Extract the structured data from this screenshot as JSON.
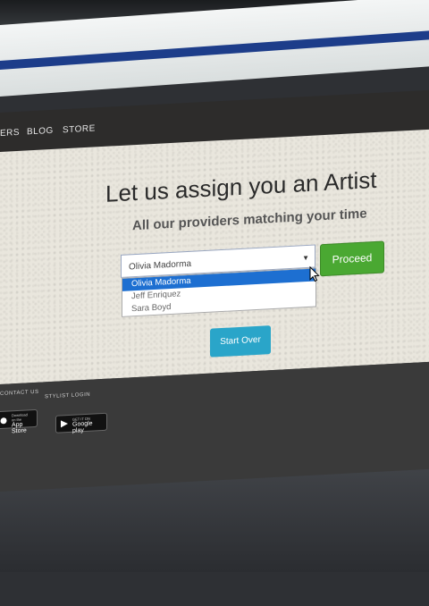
{
  "nav": {
    "items": [
      "ERS",
      "BLOG",
      "STORE"
    ]
  },
  "main": {
    "title": "Let us assign you an Artist",
    "subtitle": "All our providers matching your time"
  },
  "artist_select": {
    "value": "Olivia Madorma",
    "options": [
      "Olivia Madorma",
      "Jeff Enriquez",
      "Sara Boyd"
    ],
    "selected_index": 0
  },
  "buttons": {
    "proceed": "Proceed",
    "start_over": "Start Over"
  },
  "footer": {
    "contact": "CONTACT US",
    "stylist_login": "STYLIST LOGIN",
    "app_store_small": "Download on the",
    "app_store": "App Store",
    "google_small": "GET IT ON",
    "google_play": "Google play"
  },
  "colors": {
    "proceed": "#4aa832",
    "start_over": "#2aa5c9",
    "selected_option": "#1d6fd1",
    "navbar": "#2d2c2b"
  }
}
